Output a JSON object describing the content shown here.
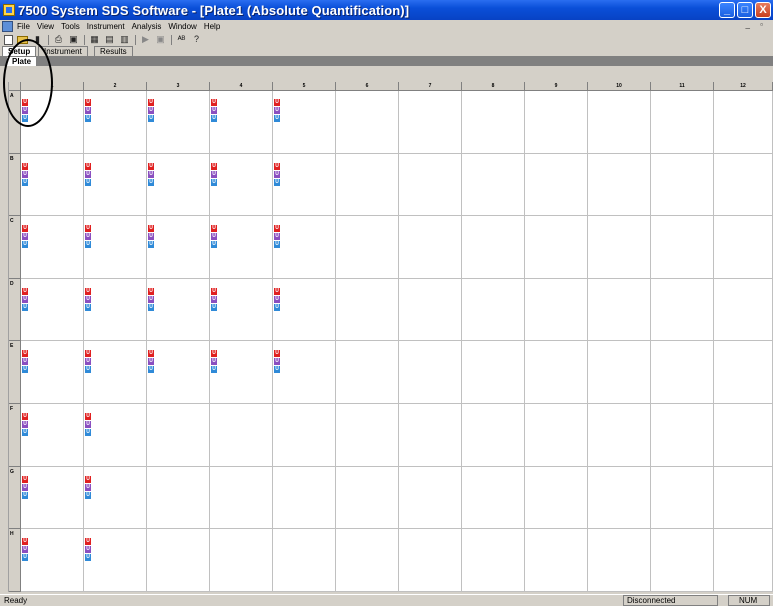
{
  "window": {
    "title": "7500 System SDS Software - [Plate1 (Absolute Quantification)]",
    "min_glyph": "_",
    "max_glyph": "□",
    "close_glyph": "X"
  },
  "menu": {
    "items": [
      "File",
      "View",
      "Tools",
      "Instrument",
      "Analysis",
      "Window",
      "Help"
    ],
    "mdi_controls": "_ ▫"
  },
  "tabs": {
    "top": [
      "Setup",
      "Instrument",
      "Results"
    ],
    "sub": "Plate"
  },
  "plate": {
    "columns": [
      "1",
      "2",
      "3",
      "4",
      "5",
      "6",
      "7",
      "8",
      "9",
      "10",
      "11",
      "12"
    ],
    "rows": [
      "A",
      "B",
      "C",
      "D",
      "E",
      "F",
      "G",
      "H"
    ],
    "marker_label": "U",
    "marker_colors": [
      "#e02020",
      "#8a4fc0",
      "#2f8ad8"
    ],
    "filled_columns_per_row": {
      "A": 5,
      "B": 5,
      "C": 5,
      "D": 5,
      "E": 5,
      "F": 2,
      "G": 2,
      "H": 2
    }
  },
  "status": {
    "left": "Ready",
    "connection": "Disconnected",
    "num": "NUM"
  }
}
